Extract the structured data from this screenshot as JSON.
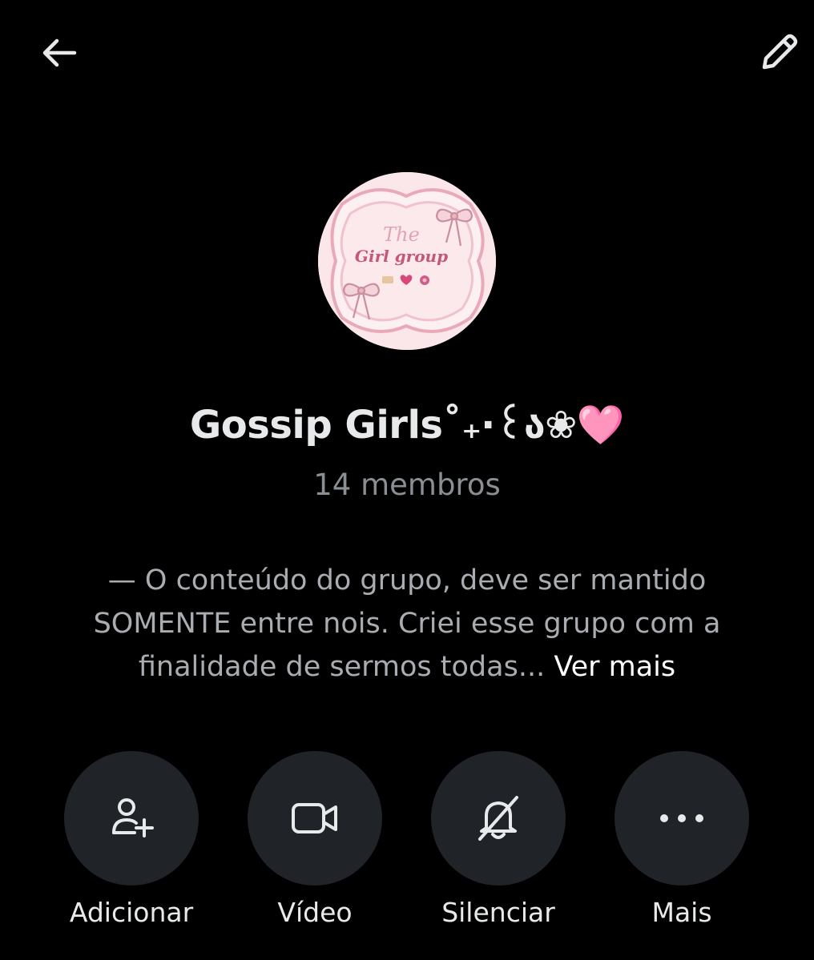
{
  "header": {
    "back_icon": "arrow-left-icon",
    "edit_icon": "pencil-icon"
  },
  "group": {
    "avatar_text_line1": "The",
    "avatar_text_line2": "Girl group",
    "name": "Gossip Girls˚₊‧꒰ა❀🩷",
    "members": "14 membros",
    "description": "— O conteúdo do grupo, deve ser mantido SOMENTE entre nois. Criei esse grupo com a finalidade de sermos todas...",
    "see_more": "Ver mais"
  },
  "actions": [
    {
      "label": "Adicionar",
      "icon": "add-person-icon"
    },
    {
      "label": "Vídeo",
      "icon": "video-camera-icon"
    },
    {
      "label": "Silenciar",
      "icon": "bell-off-icon"
    },
    {
      "label": "Mais",
      "icon": "more-dots-icon"
    }
  ],
  "colors": {
    "background": "#000000",
    "primary_text": "#e7e9ea",
    "secondary_text": "#8b8f94",
    "button_bg": "#202327"
  }
}
